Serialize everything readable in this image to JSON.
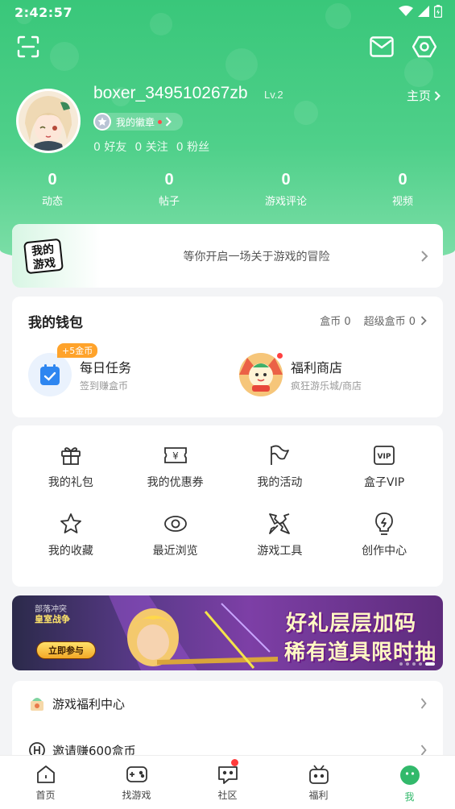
{
  "status_bar": {
    "time": "2:42:57"
  },
  "profile": {
    "username": "boxer_349510267zb",
    "level": "Lv.2",
    "homepage_label": "主页",
    "badge_label": "我的徽章",
    "friends": "0 好友",
    "following": "0 关注",
    "fans": "0 粉丝"
  },
  "stats": [
    {
      "value": "0",
      "label": "动态"
    },
    {
      "value": "0",
      "label": "帖子"
    },
    {
      "value": "0",
      "label": "游戏评论"
    },
    {
      "value": "0",
      "label": "视频"
    }
  ],
  "adventure_banner": {
    "logo_text": "我的游戏",
    "slogan": "等你开启一场关于游戏的冒险"
  },
  "wallet": {
    "title": "我的钱包",
    "coins": "盒币 0",
    "super_coins": "超级盒币 0",
    "daily_task": {
      "title": "每日任务",
      "subtitle": "签到赚盒币",
      "tag": "+5金币"
    },
    "shop": {
      "title": "福利商店",
      "subtitle": "疯狂游乐城/商店"
    }
  },
  "grid_items": [
    {
      "label": "我的礼包",
      "icon": "gift-icon"
    },
    {
      "label": "我的优惠券",
      "icon": "coupon-icon"
    },
    {
      "label": "我的活动",
      "icon": "flag-icon"
    },
    {
      "label": "盒子VIP",
      "icon": "vip-icon"
    },
    {
      "label": "我的收藏",
      "icon": "star-icon"
    },
    {
      "label": "最近浏览",
      "icon": "eye-icon"
    },
    {
      "label": "游戏工具",
      "icon": "tools-icon"
    },
    {
      "label": "创作中心",
      "icon": "bulb-icon"
    }
  ],
  "promo_banner": {
    "game_line1": "部落冲突",
    "game_line2": "皇室战争",
    "button": "立即参与",
    "headline1": "好礼层层加码",
    "headline2": "稀有道具限时抽"
  },
  "list": [
    {
      "label": "游戏福利中心",
      "icon": "welfare-icon"
    },
    {
      "label": "邀请赚600盒币",
      "icon": "invite-icon"
    }
  ],
  "tabs": [
    {
      "label": "首页",
      "icon": "home-icon"
    },
    {
      "label": "找游戏",
      "icon": "gamepad-icon"
    },
    {
      "label": "社区",
      "icon": "community-icon"
    },
    {
      "label": "福利",
      "icon": "welfare-tab-icon"
    },
    {
      "label": "我",
      "icon": "me-icon"
    }
  ],
  "colors": {
    "accent": "#32b96b",
    "hero": "#3fcb7f"
  }
}
